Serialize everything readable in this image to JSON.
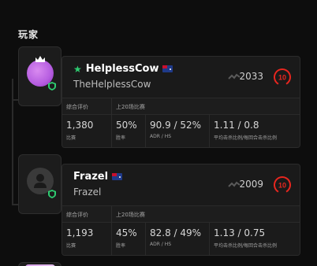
{
  "section": {
    "title": "玩家"
  },
  "players": [
    {
      "name": "HelplessCow",
      "nickname": "TheHelplessCow",
      "elo": "2033",
      "level": "10",
      "labels": {
        "overall": "综合评价",
        "recent": "上20场比赛"
      },
      "stats": [
        {
          "value": "1,380",
          "label": "比赛"
        },
        {
          "value": "50%",
          "label": "胜率"
        },
        {
          "value": "90.9 / 52%",
          "label": "ADR / HS"
        },
        {
          "value": "1.11 / 0.8",
          "label": "平均击杀比例/每回合击杀比例"
        }
      ]
    },
    {
      "name": "Frazel",
      "nickname": "Frazel",
      "elo": "2009",
      "level": "10",
      "labels": {
        "overall": "综合评价",
        "recent": "上20场比赛"
      },
      "stats": [
        {
          "value": "1,193",
          "label": "比赛"
        },
        {
          "value": "45%",
          "label": "胜率"
        },
        {
          "value": "82.8 / 49%",
          "label": "ADR / HS"
        },
        {
          "value": "1.13 / 0.75",
          "label": "平均击杀比例/每回合击杀比例"
        }
      ]
    }
  ],
  "colors": {
    "level_ring": "#e8261f",
    "star": "#2ecc71",
    "background": "#0d0d0d",
    "card": "#1a1a1a"
  },
  "icons": [
    "star-icon",
    "australia-flag-icon",
    "trend-icon",
    "level-ring-icon",
    "crown-icon",
    "shield-badge-icon",
    "default-avatar-icon"
  ]
}
